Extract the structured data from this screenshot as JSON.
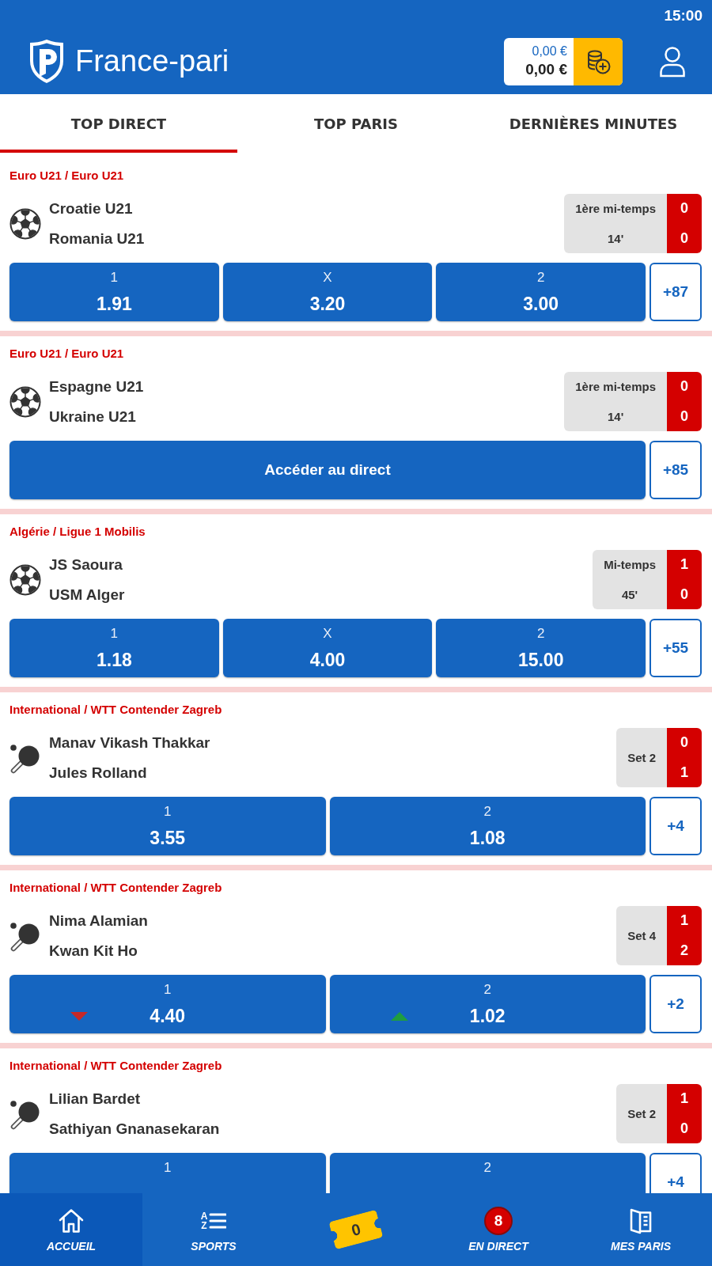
{
  "status_bar": {
    "time": "15:00"
  },
  "header": {
    "logo_text": "France-pari",
    "balance": [
      "0,00 €",
      "0,00 €"
    ]
  },
  "tabs": [
    {
      "label": "TOP DIRECT",
      "selected": true
    },
    {
      "label": "TOP PARIS",
      "selected": false
    },
    {
      "label": "DERNIÈRES MINUTES",
      "selected": false
    }
  ],
  "matches": [
    {
      "kind": "football",
      "league": "Euro U21 / Euro U21",
      "teams": [
        "Croatie U21",
        "Romania U21"
      ],
      "score": {
        "period": "1ère mi-temps",
        "clock": "14'",
        "home": "0",
        "away": "0"
      },
      "odds": [
        {
          "label": "1",
          "value": "1.91",
          "falling": false,
          "rising": false
        },
        {
          "label": "X",
          "value": "3.20",
          "falling": false,
          "rising": false
        },
        {
          "label": "2",
          "value": "3.00",
          "falling": false,
          "rising": false
        }
      ],
      "more": "+87"
    },
    {
      "kind": "football",
      "league": "Euro U21 / Euro U21",
      "teams": [
        "Espagne U21",
        "Ukraine U21"
      ],
      "score": {
        "period": "1ère mi-temps",
        "clock": "14'",
        "home": "0",
        "away": "0"
      },
      "link": "Accéder au direct",
      "more": "+85"
    },
    {
      "kind": "football",
      "league": "Algérie / Ligue 1 Mobilis",
      "teams": [
        "JS Saoura",
        "USM Alger"
      ],
      "score": {
        "period": "Mi-temps",
        "clock": "45'",
        "home": "1",
        "away": "0"
      },
      "odds": [
        {
          "label": "1",
          "value": "1.18",
          "falling": false,
          "rising": false
        },
        {
          "label": "X",
          "value": "4.00",
          "falling": false,
          "rising": false
        },
        {
          "label": "2",
          "value": "15.00",
          "falling": false,
          "rising": false
        }
      ],
      "more": "+55"
    },
    {
      "kind": "table_tennis",
      "league": "International / WTT Contender Zagreb",
      "teams": [
        "Manav Vikash Thakkar",
        "Jules Rolland"
      ],
      "score": {
        "period": "Set 2",
        "home": "0",
        "away": "1"
      },
      "odds": [
        {
          "label": "1",
          "value": "3.55",
          "falling": false,
          "rising": false
        },
        {
          "label": "2",
          "value": "1.08",
          "falling": false,
          "rising": false
        }
      ],
      "more": "+4"
    },
    {
      "kind": "table_tennis",
      "league": "International / WTT Contender Zagreb",
      "teams": [
        "Nima Alamian",
        "Kwan Kit Ho"
      ],
      "score": {
        "period": "Set 4",
        "home": "1",
        "away": "2"
      },
      "odds": [
        {
          "label": "1",
          "value": "4.40",
          "falling": true,
          "rising": false
        },
        {
          "label": "2",
          "value": "1.02",
          "falling": false,
          "rising": true
        }
      ],
      "more": "+2"
    },
    {
      "kind": "table_tennis",
      "league": "International / WTT Contender Zagreb",
      "teams": [
        "Lilian Bardet",
        "Sathiyan Gnanasekaran"
      ],
      "score": {
        "period": "Set 2",
        "home": "1",
        "away": "0"
      },
      "odds": [
        {
          "label": "1",
          "falling": false,
          "rising": false
        },
        {
          "label": "2",
          "falling": false,
          "rising": false
        }
      ],
      "more": "+4"
    }
  ],
  "bottom_nav": [
    {
      "kind": "home",
      "label": "ACCUEIL",
      "selected": true
    },
    {
      "kind": "sports",
      "label": "SPORTS",
      "icon_letters": [
        "A",
        "Z"
      ],
      "selected": false
    },
    {
      "kind": "betslip",
      "count": "0",
      "selected": false
    },
    {
      "kind": "live",
      "label": "EN DIRECT",
      "badge": "8",
      "selected": false
    },
    {
      "kind": "my_bets",
      "label": "MES PARIS",
      "selected": false
    }
  ]
}
